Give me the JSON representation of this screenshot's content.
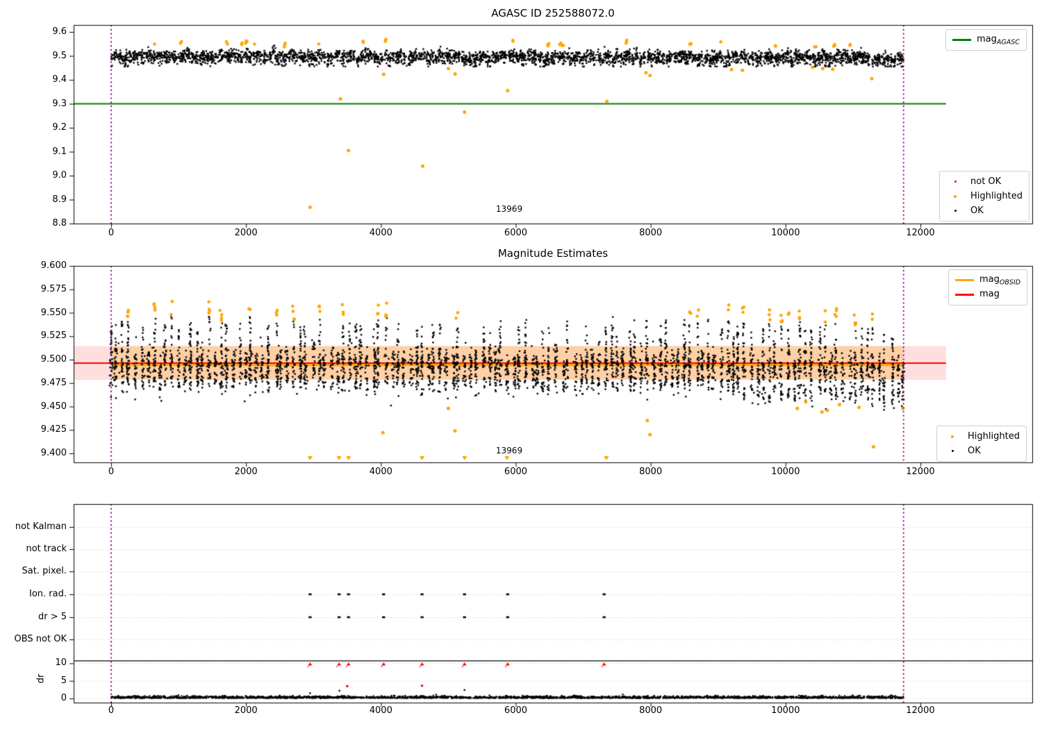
{
  "colors": {
    "green": "#007f00",
    "orange": "#ffa500",
    "red": "#ff0000",
    "purple": "#800080",
    "black": "#000000",
    "grid": "#c8c8c8",
    "band_pink": "rgba(255,0,0,0.13)",
    "band_orange": "rgba(255,165,0,0.26)"
  },
  "xticks": {
    "values": [
      0,
      2000,
      4000,
      6000,
      8000,
      10000,
      12000
    ],
    "labels": [
      "0",
      "2000",
      "4000",
      "6000",
      "8000",
      "10000",
      "12000"
    ]
  },
  "legends": {
    "p1_line": {
      "entries": [
        {
          "main": "mag",
          "sub": "AGASC",
          "color": "green"
        }
      ]
    },
    "p1_markers": {
      "entries": [
        {
          "label": "not OK",
          "color": "red"
        },
        {
          "label": "Highlighted",
          "color": "orange"
        },
        {
          "label": "OK",
          "color": "black"
        }
      ]
    },
    "p2_lines": {
      "entries": [
        {
          "main": "mag",
          "sub": "OBSID",
          "color": "orange"
        },
        {
          "main": "mag",
          "sub": "",
          "color": "red"
        }
      ]
    },
    "p2_markers": {
      "entries": [
        {
          "label": "Highlighted",
          "color": "orange"
        },
        {
          "label": "OK",
          "color": "black"
        }
      ]
    }
  },
  "chart_data": [
    {
      "type": "scatter",
      "title": "AGASC ID 252588072.0",
      "xlim": [
        -570,
        13640
      ],
      "ylim": [
        8.8,
        9.63
      ],
      "yticks": [
        9.6,
        9.5,
        9.4,
        9.3,
        9.2,
        9.1,
        9.0,
        8.9,
        8.8
      ],
      "ytick_labels": [
        "9.6",
        "9.5",
        "9.4",
        "9.3",
        "9.2",
        "9.1",
        "9.0",
        "8.9",
        "8.8"
      ],
      "grid": false,
      "legend_positions": [
        "upper right",
        "lower right"
      ],
      "mag_agasc_line": {
        "label": "mag_AGASC",
        "y": 9.3,
        "x_start": -570,
        "x_end": 12380,
        "color": "green"
      },
      "vlines": {
        "color": "purple",
        "style": "dotted",
        "x": [
          0,
          11750
        ]
      },
      "annotation": {
        "text": "13969",
        "x": 5900,
        "y": 8.835
      },
      "series": {
        "ok": {
          "label": "OK",
          "color": "black",
          "model": {
            "type": "clustered-noise",
            "x_range": [
              0,
              11750
            ],
            "clusters": 206,
            "spacing": 57.3,
            "mean": 9.501,
            "drift_per_x": -8e-07,
            "cluster_sigma": 0.0075,
            "point_sigma": 0.011,
            "points_per_cluster": 15,
            "extra_uniform": 650,
            "y_clip": [
              9.4555,
              9.5435
            ],
            "seed": 101
          }
        },
        "highlighted": {
          "label": "Highlighted",
          "color": "orange",
          "top_band": [
            9.548,
            9.566
          ],
          "outliers": [
            [
              2950,
              8.868
            ],
            [
              3400,
              9.32
            ],
            [
              3520,
              9.105
            ],
            [
              4040,
              9.423
            ],
            [
              4620,
              9.04
            ],
            [
              5000,
              9.447
            ],
            [
              5100,
              9.425
            ],
            [
              5240,
              9.265
            ],
            [
              5880,
              9.355
            ],
            [
              7350,
              9.31
            ],
            [
              7930,
              9.43
            ],
            [
              7990,
              9.418
            ],
            [
              9200,
              9.443
            ],
            [
              9360,
              9.44
            ],
            [
              10400,
              9.452
            ],
            [
              10550,
              9.447
            ],
            [
              10700,
              9.444
            ],
            [
              11280,
              9.405
            ]
          ]
        },
        "not_ok": {
          "label": "not OK",
          "color": "red",
          "outliers": []
        }
      }
    },
    {
      "type": "scatter",
      "title": "Magnitude Estimates",
      "xlim": [
        -570,
        13640
      ],
      "ylim": [
        9.39,
        9.6
      ],
      "yticks": [
        9.6,
        9.575,
        9.55,
        9.525,
        9.5,
        9.475,
        9.45,
        9.425,
        9.4
      ],
      "ytick_labels": [
        "9.600",
        "9.575",
        "9.550",
        "9.525",
        "9.500",
        "9.475",
        "9.450",
        "9.425",
        "9.400"
      ],
      "grid": false,
      "mag_line": {
        "label": "mag",
        "y": 9.4963,
        "x_start": -570,
        "x_end": 12380,
        "color": "red"
      },
      "mag_obsid_line": {
        "label": "mag_OBSID",
        "y": 9.4952,
        "x_range": [
          0,
          11750
        ],
        "color": "orange"
      },
      "band": {
        "lo": 9.4785,
        "hi": 9.5145,
        "pink_x": [
          -570,
          12380
        ],
        "orange_x": [
          0,
          11750
        ]
      },
      "vlines": {
        "color": "purple",
        "style": "dotted",
        "x": [
          0,
          11750
        ]
      },
      "annotation": {
        "text": "13969",
        "x": 5900,
        "y": 9.397
      },
      "series": {
        "ok": {
          "label": "OK",
          "color": "black",
          "model": {
            "type": "clustered-columns",
            "x_range": [
              0,
              11750
            ],
            "clusters": 131,
            "spacing": 90.4,
            "mean": 9.4962,
            "drift_per_x": -2.2e-07,
            "extra_drift_after_x": 8000,
            "extra_drift_per_x": -2.1e-06,
            "core_sigma": 0.0085,
            "column_top": 9.5455,
            "tail_depth": 0.03,
            "y_clip": [
              9.4465,
              9.5455
            ],
            "seed": 202
          },
          "low_outliers": [
            [
              1980,
              9.4555
            ],
            [
              2060,
              9.462
            ],
            [
              4150,
              9.451
            ],
            [
              2755,
              9.4635
            ],
            [
              3050,
              9.468
            ],
            [
              5450,
              9.464
            ],
            [
              6900,
              9.462
            ]
          ]
        },
        "highlighted": {
          "label": "Highlighted",
          "color": "orange",
          "top_band": [
            9.546,
            9.567
          ],
          "outliers": [
            [
              4030,
              9.422
            ],
            [
              5000,
              9.448
            ],
            [
              5100,
              9.424
            ],
            [
              7950,
              9.435
            ],
            [
              7990,
              9.42
            ],
            [
              10175,
              9.448
            ],
            [
              10300,
              9.455
            ],
            [
              10540,
              9.444
            ],
            [
              10620,
              9.446
            ],
            [
              10800,
              9.452
            ],
            [
              11090,
              9.449
            ],
            [
              11740,
              9.448
            ],
            [
              11305,
              9.407
            ]
          ],
          "clipped_low_x": [
            2950,
            3380,
            3520,
            4610,
            5242,
            5870,
            7343
          ],
          "clip_y": 9.392
        }
      }
    },
    {
      "type": "scatter",
      "title": "",
      "xlim": [
        -570,
        13640
      ],
      "grid": true,
      "categories": [
        "not Kalman",
        "not track",
        "Sat. pixel.",
        "Ion. rad.",
        "dr > 5",
        "OBS not OK"
      ],
      "flags": [
        {
          "row": "Ion. rad.",
          "x": [
            2950,
            3380,
            3520,
            4040,
            4610,
            5240,
            5880,
            7310
          ]
        },
        {
          "row": "dr > 5",
          "x": [
            2950,
            3380,
            3520,
            4040,
            4610,
            5240,
            5880,
            7310
          ]
        }
      ],
      "dr": {
        "label": "dr",
        "ticks": [
          10,
          5,
          0
        ],
        "tick_labels": [
          "10",
          "5",
          "0"
        ],
        "separator_y": 10.7,
        "noise": {
          "n": 2600,
          "x_range": [
            0,
            11750
          ],
          "base": 0.1,
          "sigma": 0.27,
          "seed": 303
        },
        "red_clipped": {
          "y": 9.8,
          "x": [
            2950,
            3380,
            3520,
            4040,
            4610,
            5240,
            5880,
            7310
          ]
        },
        "red_points": [
          [
            3500,
            3.5
          ],
          [
            4610,
            3.6
          ]
        ],
        "black_points": [
          [
            2950,
            1.5
          ],
          [
            3385,
            2.2
          ],
          [
            5240,
            2.4
          ]
        ]
      },
      "vlines": {
        "color": "purple",
        "style": "dotted",
        "x": [
          0,
          11750
        ]
      }
    }
  ]
}
